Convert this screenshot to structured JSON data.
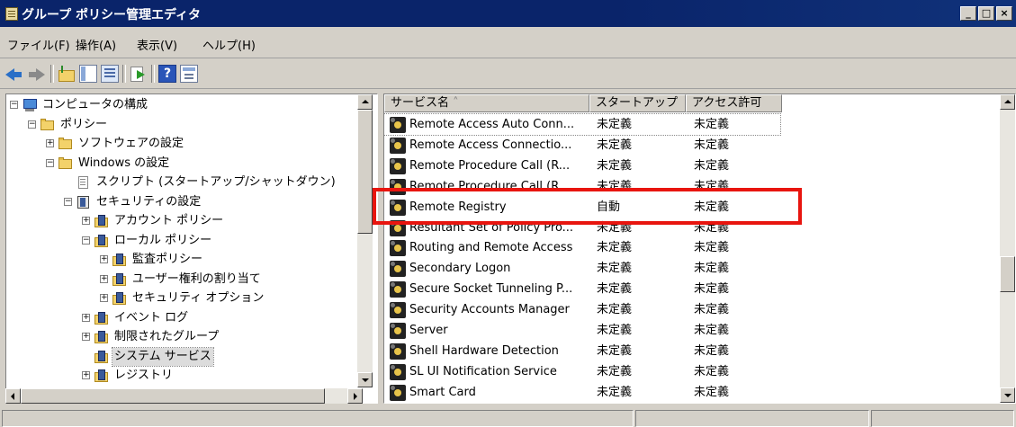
{
  "window": {
    "title": "グループ ポリシー管理エディタ"
  },
  "menu": [
    "ファイル(F)",
    "操作(A)",
    "表示(V)",
    "ヘルプ(H)"
  ],
  "tree": [
    {
      "label": "コンピュータの構成",
      "indent": 0,
      "icon": "computer-icon",
      "expander": "minus"
    },
    {
      "label": "ポリシー",
      "indent": 1,
      "icon": "folder-icon",
      "expander": "minus"
    },
    {
      "label": "ソフトウェアの設定",
      "indent": 2,
      "icon": "folder-icon",
      "expander": "plus"
    },
    {
      "label": "Windows の設定",
      "indent": 2,
      "icon": "folder-icon",
      "expander": "minus"
    },
    {
      "label": "スクリプト (スタートアップ/シャットダウン)",
      "indent": 3,
      "icon": "script-icon",
      "expander": ""
    },
    {
      "label": "セキュリティの設定",
      "indent": 3,
      "icon": "security-settings-icon",
      "expander": "minus"
    },
    {
      "label": "アカウント ポリシー",
      "indent": 4,
      "icon": "security-folder-icon",
      "expander": "plus"
    },
    {
      "label": "ローカル ポリシー",
      "indent": 4,
      "icon": "security-folder-icon",
      "expander": "minus"
    },
    {
      "label": "監査ポリシー",
      "indent": 5,
      "icon": "security-folder-icon",
      "expander": "plus"
    },
    {
      "label": "ユーザー権利の割り当て",
      "indent": 5,
      "icon": "security-folder-icon",
      "expander": "plus"
    },
    {
      "label": "セキュリティ オプション",
      "indent": 5,
      "icon": "security-folder-icon",
      "expander": "plus"
    },
    {
      "label": "イベント ログ",
      "indent": 4,
      "icon": "security-folder-icon",
      "expander": "plus"
    },
    {
      "label": "制限されたグループ",
      "indent": 4,
      "icon": "security-folder-icon",
      "expander": "plus"
    },
    {
      "label": "システム サービス",
      "indent": 4,
      "icon": "security-folder-icon",
      "expander": "",
      "selected": true
    },
    {
      "label": "レジストリ",
      "indent": 4,
      "icon": "security-folder-icon",
      "expander": "plus"
    }
  ],
  "columns": [
    "サービス名",
    "スタートアップ",
    "アクセス許可"
  ],
  "services": [
    {
      "name": "Remote Access Auto Conn...",
      "startup": "未定義",
      "perm": "未定義"
    },
    {
      "name": "Remote Access Connectio...",
      "startup": "未定義",
      "perm": "未定義"
    },
    {
      "name": "Remote Procedure Call (R...",
      "startup": "未定義",
      "perm": "未定義"
    },
    {
      "name": "Remote Procedure Call (R...",
      "startup": "未定義",
      "perm": "未定義"
    },
    {
      "name": "Remote Registry",
      "startup": "自動",
      "perm": "未定義"
    },
    {
      "name": "Resultant Set of Policy Pro...",
      "startup": "未定義",
      "perm": "未定義"
    },
    {
      "name": "Routing and Remote Access",
      "startup": "未定義",
      "perm": "未定義"
    },
    {
      "name": "Secondary Logon",
      "startup": "未定義",
      "perm": "未定義"
    },
    {
      "name": "Secure Socket Tunneling P...",
      "startup": "未定義",
      "perm": "未定義"
    },
    {
      "name": "Security Accounts Manager",
      "startup": "未定義",
      "perm": "未定義"
    },
    {
      "name": "Server",
      "startup": "未定義",
      "perm": "未定義"
    },
    {
      "name": "Shell Hardware Detection",
      "startup": "未定義",
      "perm": "未定義"
    },
    {
      "name": "SL UI Notification Service",
      "startup": "未定義",
      "perm": "未定義"
    },
    {
      "name": "Smart Card",
      "startup": "未定義",
      "perm": "未定義"
    }
  ],
  "colors": {
    "highlight": "#e8150f",
    "titlebar": "#0a246a",
    "selection": "#0a246a"
  }
}
